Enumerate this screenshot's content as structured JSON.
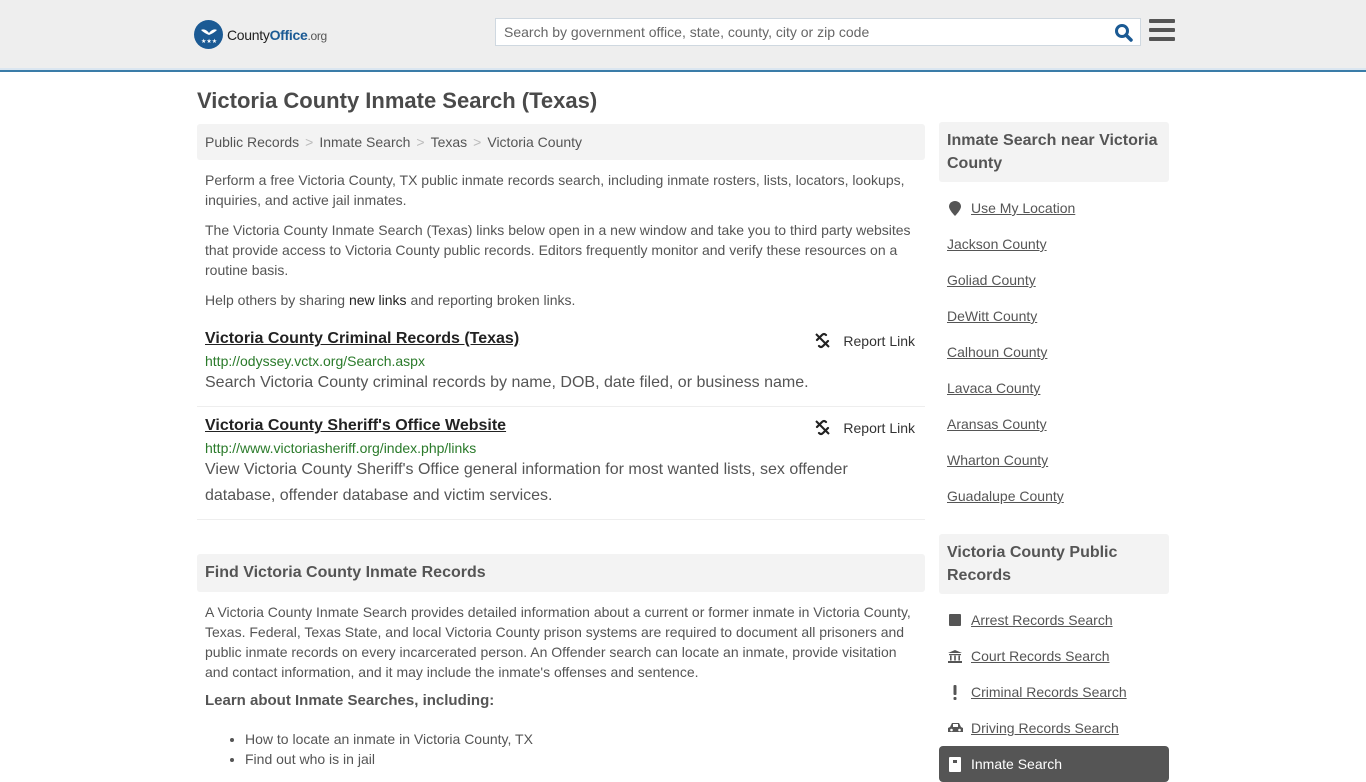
{
  "header": {
    "logo": {
      "brand_prefix": "County",
      "brand_main": "Office",
      "brand_suffix": ".org"
    },
    "search": {
      "placeholder": "Search by government office, state, county, city or zip code",
      "value": ""
    },
    "icons": {
      "search": "search-icon",
      "menu": "hamburger-menu-icon"
    }
  },
  "page": {
    "title": "Victoria County Inmate Search (Texas)",
    "breadcrumb": [
      "Public Records",
      "Inmate Search",
      "Texas",
      "Victoria County"
    ]
  },
  "intro": {
    "p1": "Perform a free Victoria County, TX public inmate records search, including inmate rosters, lists, locators, lookups, inquiries, and active jail inmates.",
    "p2": "The Victoria County Inmate Search (Texas) links below open in a new window and take you to third party websites that provide access to Victoria County public records. Editors frequently monitor and verify these resources on a routine basis.",
    "p3_before": "Help others by sharing ",
    "p3_link": "new links",
    "p3_after": " and reporting broken links."
  },
  "links": [
    {
      "title": "Victoria County Criminal Records (Texas)",
      "url": "http://odyssey.vctx.org/Search.aspx",
      "description": "Search Victoria County criminal records by name, DOB, date filed, or business name.",
      "report_label": "Report Link"
    },
    {
      "title": "Victoria County Sheriff's Office Website",
      "url": "http://www.victoriasheriff.org/index.php/links",
      "description": "View Victoria County Sheriff's Office general information for most wanted lists, sex offender database, offender database and victim services.",
      "report_label": "Report Link"
    }
  ],
  "find_section": {
    "header": "Find Victoria County Inmate Records",
    "body": "A Victoria County Inmate Search provides detailed information about a current or former inmate in Victoria County, Texas. Federal, Texas State, and local Victoria County prison systems are required to document all prisoners and public inmate records on every incarcerated person. An Offender search can locate an inmate, provide visitation and contact information, and it may include the inmate's offenses and sentence.",
    "learn_heading": "Learn about Inmate Searches, including:",
    "learn_items": [
      "How to locate an inmate in Victoria County, TX",
      "Find out who is in jail"
    ]
  },
  "sidebar": {
    "nearby": {
      "header": "Inmate Search near Victoria County",
      "use_location": "Use My Location",
      "counties": [
        "Jackson County",
        "Goliad County",
        "DeWitt County",
        "Calhoun County",
        "Lavaca County",
        "Aransas County",
        "Wharton County",
        "Guadalupe County"
      ]
    },
    "records": {
      "header": "Victoria County Public Records",
      "items": [
        {
          "label": "Arrest Records Search",
          "icon": "square-icon"
        },
        {
          "label": "Court Records Search",
          "icon": "courthouse-icon"
        },
        {
          "label": "Criminal Records Search",
          "icon": "exclamation-icon"
        },
        {
          "label": "Driving Records Search",
          "icon": "car-icon"
        },
        {
          "label": "Inmate Search",
          "icon": "jail-door-icon",
          "active": true
        }
      ]
    }
  }
}
